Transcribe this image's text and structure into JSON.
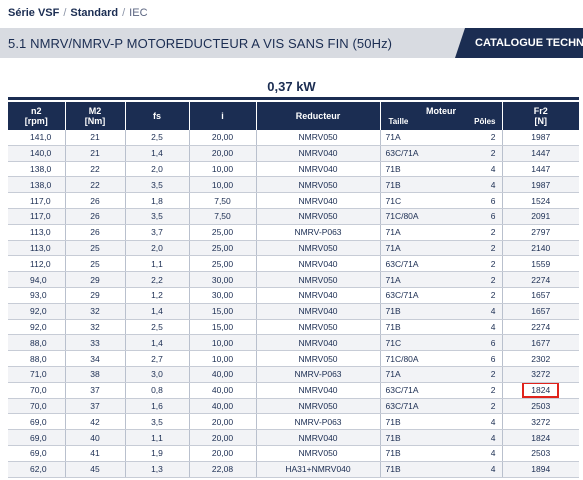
{
  "breadcrumb": {
    "series": "Série VSF",
    "separator": "/",
    "standard": "Standard",
    "iec": "IEC"
  },
  "title": "5.1 NMRV/NMRV-P MOTOREDUCTEUR A VIS SANS FIN (50Hz)",
  "catalogue_tab": "CATALOGUE TECHNIC",
  "power": "0,37 kW",
  "headers": {
    "n2": "n2",
    "n2_unit": "[rpm]",
    "m2": "M2",
    "m2_unit": "[Nm]",
    "fs": "fs",
    "i": "i",
    "reducteur": "Reducteur",
    "moteur": "Moteur",
    "taille": "Taille",
    "poles": "Pôles",
    "fr2": "Fr2",
    "fr2_unit": "[N]"
  },
  "rows": [
    [
      "141,0",
      "21",
      "2,5",
      "20,00",
      "NMRV050",
      "71A",
      "2",
      "1987"
    ],
    [
      "140,0",
      "21",
      "1,4",
      "20,00",
      "NMRV040",
      "63C/71A",
      "2",
      "1447"
    ],
    [
      "138,0",
      "22",
      "2,0",
      "10,00",
      "NMRV040",
      "71B",
      "4",
      "1447"
    ],
    [
      "138,0",
      "22",
      "3,5",
      "10,00",
      "NMRV050",
      "71B",
      "4",
      "1987"
    ],
    [
      "117,0",
      "26",
      "1,8",
      "7,50",
      "NMRV040",
      "71C",
      "6",
      "1524"
    ],
    [
      "117,0",
      "26",
      "3,5",
      "7,50",
      "NMRV050",
      "71C/80A",
      "6",
      "2091"
    ],
    [
      "113,0",
      "26",
      "3,7",
      "25,00",
      "NMRV-P063",
      "71A",
      "2",
      "2797"
    ],
    [
      "113,0",
      "25",
      "2,0",
      "25,00",
      "NMRV050",
      "71A",
      "2",
      "2140"
    ],
    [
      "112,0",
      "25",
      "1,1",
      "25,00",
      "NMRV040",
      "63C/71A",
      "2",
      "1559"
    ],
    [
      "94,0",
      "29",
      "2,2",
      "30,00",
      "NMRV050",
      "71A",
      "2",
      "2274"
    ],
    [
      "93,0",
      "29",
      "1,2",
      "30,00",
      "NMRV040",
      "63C/71A",
      "2",
      "1657"
    ],
    [
      "92,0",
      "32",
      "1,4",
      "15,00",
      "NMRV040",
      "71B",
      "4",
      "1657"
    ],
    [
      "92,0",
      "32",
      "2,5",
      "15,00",
      "NMRV050",
      "71B",
      "4",
      "2274"
    ],
    [
      "88,0",
      "33",
      "1,4",
      "10,00",
      "NMRV040",
      "71C",
      "6",
      "1677"
    ],
    [
      "88,0",
      "34",
      "2,7",
      "10,00",
      "NMRV050",
      "71C/80A",
      "6",
      "2302"
    ],
    [
      "71,0",
      "38",
      "3,0",
      "40,00",
      "NMRV-P063",
      "71A",
      "2",
      "3272"
    ],
    [
      "70,0",
      "37",
      "0,8",
      "40,00",
      "NMRV040",
      "63C/71A",
      "2",
      "1824"
    ],
    [
      "70,0",
      "37",
      "1,6",
      "40,00",
      "NMRV050",
      "63C/71A",
      "2",
      "2503"
    ],
    [
      "69,0",
      "42",
      "3,5",
      "20,00",
      "NMRV-P063",
      "71B",
      "4",
      "3272"
    ],
    [
      "69,0",
      "40",
      "1,1",
      "20,00",
      "NMRV040",
      "71B",
      "4",
      "1824"
    ],
    [
      "69,0",
      "41",
      "1,9",
      "20,00",
      "NMRV050",
      "71B",
      "4",
      "2503"
    ],
    [
      "62,0",
      "45",
      "1,3",
      "22,08",
      "HA31+NMRV040",
      "71B",
      "4",
      "1894"
    ]
  ],
  "highlight_row": 16,
  "colors": {
    "navy": "#1b2d52",
    "title_bar": "#d8dbe1",
    "highlight": "#e0231c"
  }
}
